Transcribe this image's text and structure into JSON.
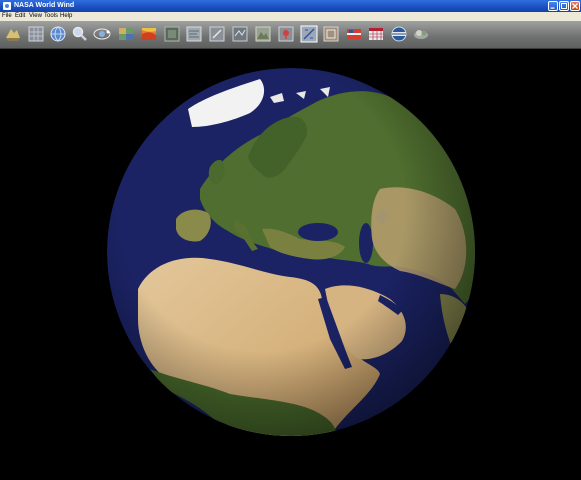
{
  "window": {
    "title": "NASA World Wind"
  },
  "menu": {
    "file": "File",
    "edit": "Edit",
    "view": "View",
    "tools": "Tools",
    "help": "Help"
  },
  "toolbar": {
    "buttons": [
      "world-icon",
      "grid-icon",
      "globe-icon",
      "search-icon",
      "satellite-icon",
      "layers-icon",
      "temperature-map-icon",
      "image-layer-icon",
      "map-icon",
      "scale-icon",
      "boundaries-icon",
      "terrain-icon",
      "places-icon",
      "favorites-icon",
      "measure-icon",
      "photo-icon",
      "chart-icon",
      "data-icon",
      "compass-icon",
      "plugin-icon"
    ]
  },
  "colors": {
    "titlebar": "#1a4fc0",
    "menubar": "#ece9d8",
    "toolbar": "#7a7b7b",
    "ocean": "#1b2364",
    "desert": "#d9b987",
    "forest": "#4a6b2c",
    "ice": "#f2f2f2"
  }
}
